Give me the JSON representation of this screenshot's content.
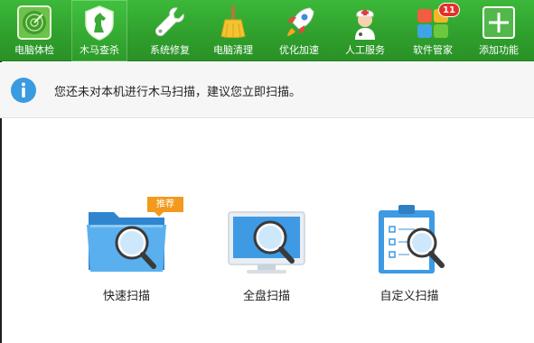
{
  "toolbar": {
    "items": [
      {
        "label": "电脑体检",
        "icon": "radar-icon"
      },
      {
        "label": "木马查杀",
        "icon": "horse-shield-icon"
      },
      {
        "label": "系统修复",
        "icon": "wrench-icon"
      },
      {
        "label": "电脑清理",
        "icon": "broom-icon"
      },
      {
        "label": "优化加速",
        "icon": "rocket-icon"
      },
      {
        "label": "人工服务",
        "icon": "doctor-icon"
      },
      {
        "label": "软件管家",
        "icon": "apps-grid-icon",
        "badge": "11"
      },
      {
        "label": "添加功能",
        "icon": "plus-icon"
      }
    ],
    "active_index": 1,
    "colors": {
      "bar": "#2f9f2c",
      "badge": "#e3302a"
    }
  },
  "notice": {
    "icon": "info-icon",
    "text": "您还未对本机进行木马扫描，建议您立即扫描。"
  },
  "scan_options": [
    {
      "label": "快速扫描",
      "icon": "folder-search-icon",
      "tag": "推荐"
    },
    {
      "label": "全盘扫描",
      "icon": "monitor-search-icon"
    },
    {
      "label": "自定义扫描",
      "icon": "clipboard-search-icon"
    }
  ],
  "colors": {
    "accent": "#3a9be0",
    "tag": "#f39a1e"
  }
}
